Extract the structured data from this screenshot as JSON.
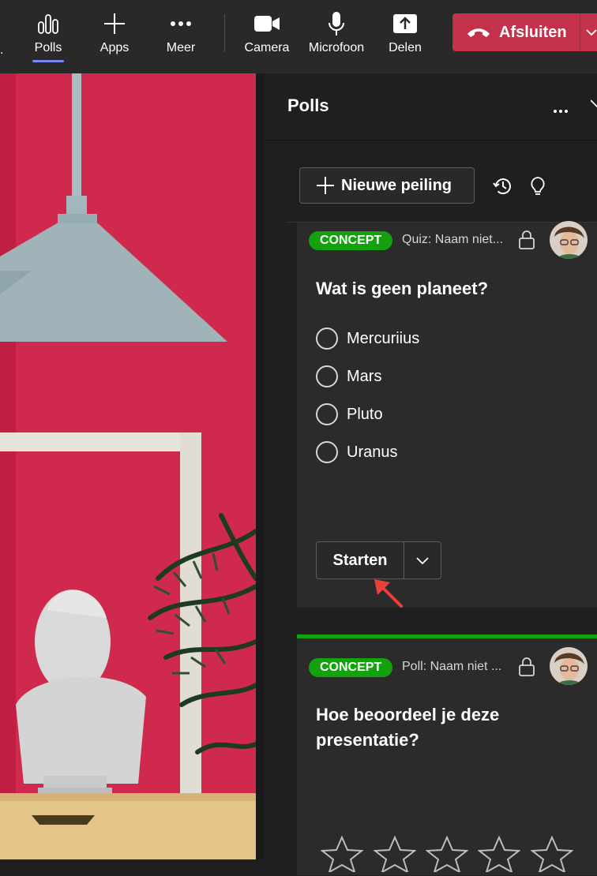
{
  "topbar": {
    "left_partial": ".",
    "items": [
      {
        "label": "Polls",
        "icon": "polls-icon",
        "active": true
      },
      {
        "label": "Apps",
        "icon": "plus-icon"
      },
      {
        "label": "Meer",
        "icon": "more-icon"
      },
      {
        "label": "Camera",
        "icon": "camera-icon"
      },
      {
        "label": "Microfoon",
        "icon": "microphone-icon"
      },
      {
        "label": "Delen",
        "icon": "share-icon"
      }
    ],
    "end_call_label": "Afsluiten"
  },
  "panel": {
    "title": "Polls",
    "new_poll_label": "Nieuwe peiling",
    "cards": [
      {
        "status": "CONCEPT",
        "type_text": "Quiz: Naam niet...",
        "question": "Wat is geen planeet?",
        "options": [
          "Mercuriius",
          "Mars",
          "Pluto",
          "Uranus"
        ],
        "start_label": "Starten"
      },
      {
        "status": "CONCEPT",
        "type_text": "Poll: Naam niet ...",
        "question": "Hoe beoordeel je deze presentatie?",
        "rating_stars": 5
      }
    ]
  },
  "colors": {
    "accent": "#7f85f5",
    "end_call": "#c4314b",
    "concept_badge": "#13a10e",
    "annotation_arrow": "#e8423c"
  }
}
